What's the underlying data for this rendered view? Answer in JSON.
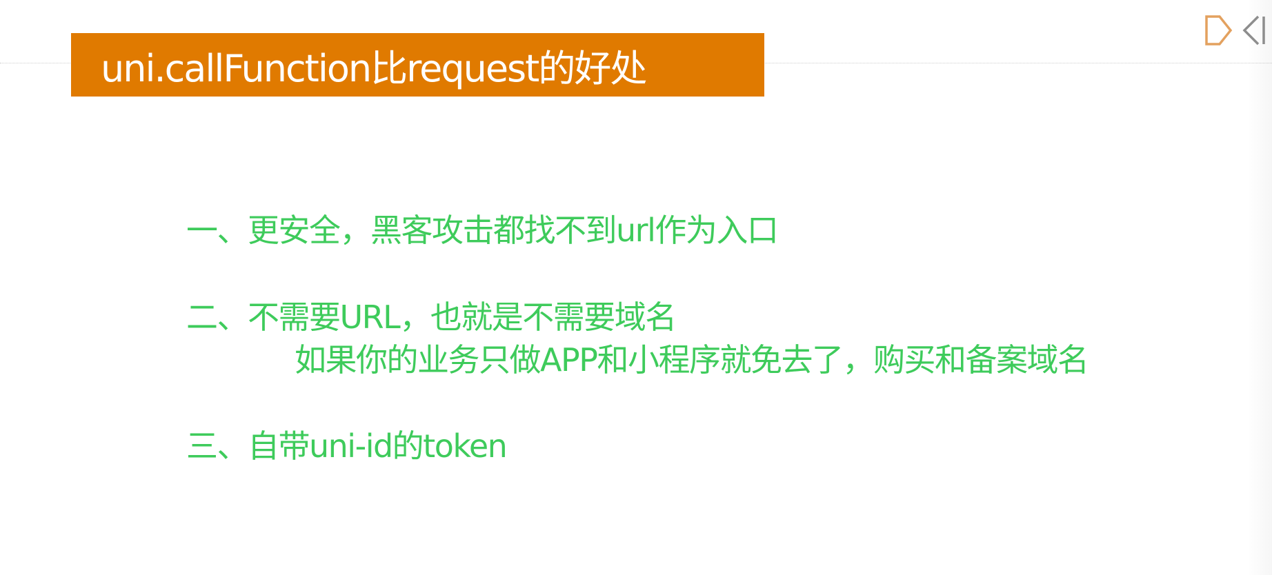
{
  "slide": {
    "title": "uni.callFunction比request的好处",
    "points": [
      "一、更安全，黑客攻击都找不到url作为入口",
      "二、不需要URL，也就是不需要域名",
      "如果你的业务只做APP和小程序就免去了，购买和备案域名",
      "三、自带uni-id的token"
    ]
  },
  "logo": {
    "icon": "dcloud-logo-icon",
    "color": "#e3a15f"
  },
  "colors": {
    "title_bg": "#e07a00",
    "title_text": "#ffffff",
    "body_text": "#3ecb5b"
  }
}
